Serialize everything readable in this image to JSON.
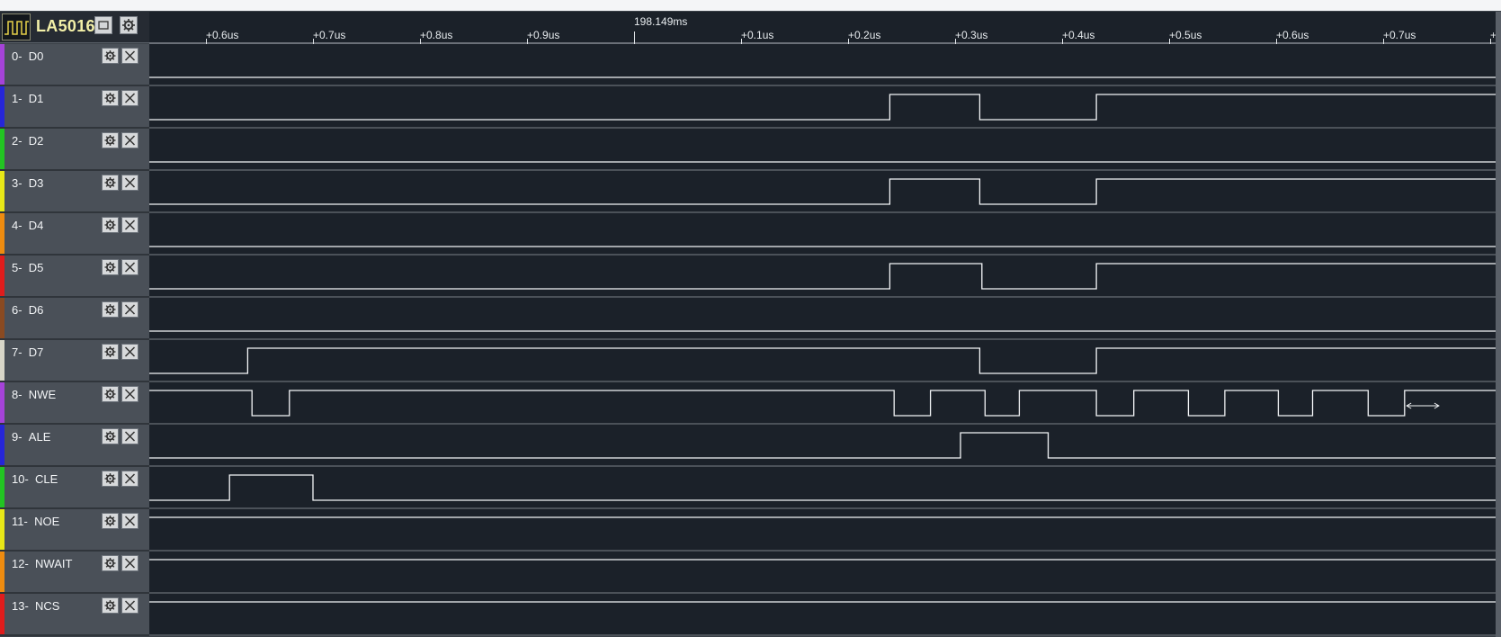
{
  "device": {
    "name": "LA5016"
  },
  "ruler": {
    "reference": "198.149ms",
    "left_ticks": [
      "+0.6us",
      "+0.7us",
      "+0.8us",
      "+0.9us"
    ],
    "right_ticks": [
      "+0.1us",
      "+0.2us",
      "+0.3us",
      "+0.4us",
      "+0.5us",
      "+0.6us",
      "+0.7us",
      "+"
    ]
  },
  "waveform_timing": {
    "time_axis": "microseconds relative to 198.149ms reference",
    "visible_range_us": [
      -0.453,
      0.806
    ]
  },
  "channels": [
    {
      "index": "0-",
      "name": "D0",
      "color": "#a543d8",
      "start": 0,
      "transitions_us": []
    },
    {
      "index": "1-",
      "name": "D1",
      "color": "#2626d8",
      "start": 0,
      "transitions_us": [
        0.239,
        0.323,
        0.432
      ]
    },
    {
      "index": "2-",
      "name": "D2",
      "color": "#22c422",
      "start": 0,
      "transitions_us": []
    },
    {
      "index": "3-",
      "name": "D3",
      "color": "#e8e817",
      "start": 0,
      "transitions_us": [
        0.239,
        0.323,
        0.432
      ]
    },
    {
      "index": "4-",
      "name": "D4",
      "color": "#ef8c10",
      "start": 0,
      "transitions_us": []
    },
    {
      "index": "5-",
      "name": "D5",
      "color": "#e01c1c",
      "start": 0,
      "transitions_us": [
        0.239,
        0.325,
        0.432
      ]
    },
    {
      "index": "6-",
      "name": "D6",
      "color": "#8a4a21",
      "start": 0,
      "transitions_us": []
    },
    {
      "index": "7-",
      "name": "D7",
      "color": "#d8d6c8",
      "start": 0,
      "transitions_us": [
        -0.361,
        0.323,
        0.432
      ]
    },
    {
      "index": "8-",
      "name": "NWE",
      "color": "#a543d8",
      "start": 1,
      "transitions_us": [
        -0.357,
        -0.322,
        0.243,
        0.277,
        0.328,
        0.36,
        0.432,
        0.467,
        0.518,
        0.552,
        0.602,
        0.634,
        0.686,
        0.72
      ]
    },
    {
      "index": "9-",
      "name": "ALE",
      "color": "#2626d8",
      "start": 0,
      "transitions_us": [
        0.305,
        0.387
      ]
    },
    {
      "index": "10-",
      "name": "CLE",
      "color": "#22c422",
      "start": 0,
      "transitions_us": [
        -0.378,
        -0.3
      ]
    },
    {
      "index": "11-",
      "name": "NOE",
      "color": "#e8e817",
      "start": 1,
      "transitions_us": []
    },
    {
      "index": "12-",
      "name": "NWAIT",
      "color": "#ef8c10",
      "start": 1,
      "transitions_us": []
    },
    {
      "index": "13-",
      "name": "NCS",
      "color": "#e01c1c",
      "start": 1,
      "transitions_us": []
    }
  ]
}
